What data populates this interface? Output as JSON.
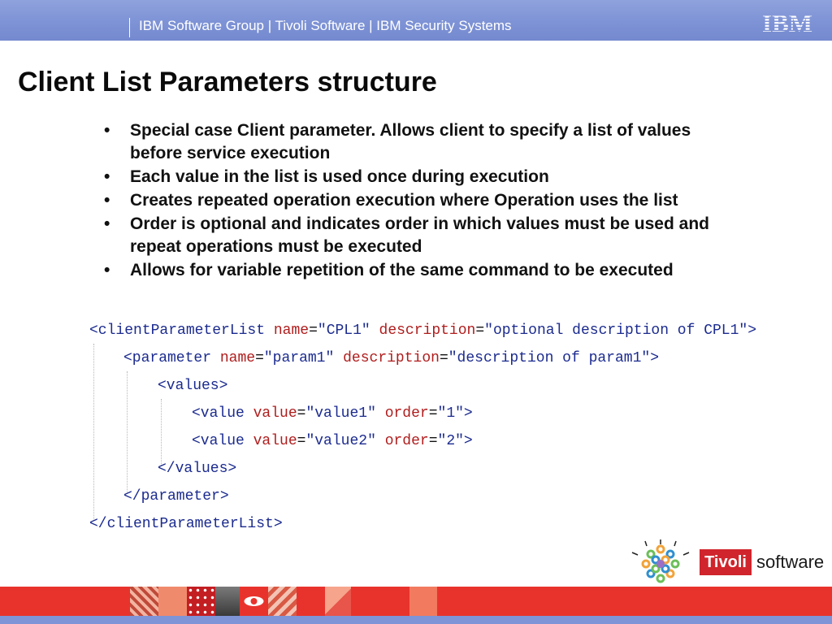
{
  "header": {
    "text": "IBM Software Group | Tivoli Software | IBM Security Systems",
    "logo_text": "IBM",
    "background_color": "#7f94d6"
  },
  "title": "Client List Parameters structure",
  "bullets": [
    "Special case Client parameter. Allows client to specify a list of values\nbefore service execution",
    "Each value in the list is used once during execution",
    "Creates repeated operation execution where Operation uses the list",
    "Order is optional and indicates order in which values must be used and\nrepeat operations must be executed",
    "Allows for variable repetition of the same command to be executed"
  ],
  "bullet_symbol": "•",
  "code_sample": {
    "lines": [
      {
        "indent": 0,
        "tokens": [
          {
            "t": "tag",
            "v": "<clientParameterList"
          },
          {
            "t": "sp",
            "v": " "
          },
          {
            "t": "attr",
            "v": "name"
          },
          {
            "t": "eq",
            "v": "="
          },
          {
            "t": "val",
            "v": "\"CPL1\""
          },
          {
            "t": "sp",
            "v": " "
          },
          {
            "t": "attr",
            "v": "description"
          },
          {
            "t": "eq",
            "v": "="
          },
          {
            "t": "val",
            "v": "\"optional description of CPL1\""
          },
          {
            "t": "tag",
            "v": ">"
          }
        ]
      },
      {
        "indent": 1,
        "tokens": [
          {
            "t": "tag",
            "v": "<parameter"
          },
          {
            "t": "sp",
            "v": " "
          },
          {
            "t": "attr",
            "v": "name"
          },
          {
            "t": "eq",
            "v": "="
          },
          {
            "t": "val",
            "v": "\"param1\""
          },
          {
            "t": "sp",
            "v": " "
          },
          {
            "t": "attr",
            "v": "description"
          },
          {
            "t": "eq",
            "v": "="
          },
          {
            "t": "val",
            "v": "\"description of param1\""
          },
          {
            "t": "tag",
            "v": ">"
          }
        ]
      },
      {
        "indent": 2,
        "tokens": [
          {
            "t": "tag",
            "v": "<values>"
          }
        ]
      },
      {
        "indent": 3,
        "tokens": [
          {
            "t": "tag",
            "v": "<value"
          },
          {
            "t": "sp",
            "v": " "
          },
          {
            "t": "attr",
            "v": "value"
          },
          {
            "t": "eq",
            "v": "="
          },
          {
            "t": "val",
            "v": "\"value1\""
          },
          {
            "t": "sp",
            "v": " "
          },
          {
            "t": "attr",
            "v": "order"
          },
          {
            "t": "eq",
            "v": "="
          },
          {
            "t": "val",
            "v": "\"1\""
          },
          {
            "t": "tag",
            "v": ">"
          }
        ]
      },
      {
        "indent": 3,
        "tokens": [
          {
            "t": "tag",
            "v": "<value"
          },
          {
            "t": "sp",
            "v": " "
          },
          {
            "t": "attr",
            "v": "value"
          },
          {
            "t": "eq",
            "v": "="
          },
          {
            "t": "val",
            "v": "\"value2\""
          },
          {
            "t": "sp",
            "v": " "
          },
          {
            "t": "attr",
            "v": "order"
          },
          {
            "t": "eq",
            "v": "="
          },
          {
            "t": "val",
            "v": "\"2\""
          },
          {
            "t": "tag",
            "v": ">"
          }
        ]
      },
      {
        "indent": 2,
        "tokens": [
          {
            "t": "tag",
            "v": "</values>"
          }
        ]
      },
      {
        "indent": 1,
        "tokens": [
          {
            "t": "tag",
            "v": "</parameter>"
          }
        ]
      },
      {
        "indent": 0,
        "tokens": [
          {
            "t": "tag",
            "v": "</clientParameterList>"
          }
        ]
      }
    ],
    "colors": {
      "tag": "#1b2b8f",
      "attr": "#b01d1d",
      "value": "#1b2b8f"
    }
  },
  "branding": {
    "badge": "Tivoli",
    "word": "software",
    "icon": "tivoli-starburst-icon",
    "badge_color": "#d0252c"
  },
  "footer": {
    "band_color": "#e8332c",
    "bar_color": "#7f94d6"
  }
}
